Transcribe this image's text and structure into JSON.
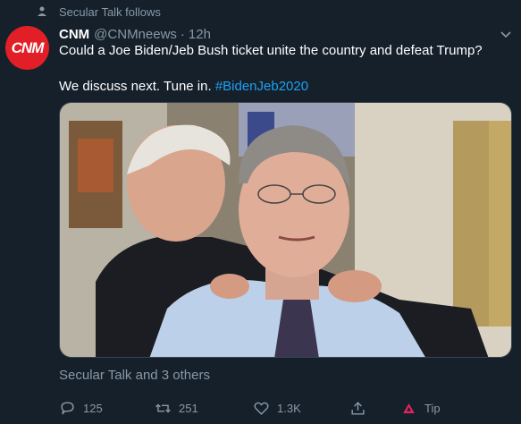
{
  "social_context": {
    "text": "Secular Talk follows",
    "icon": "person-icon"
  },
  "author": {
    "avatar_text": "CNM",
    "name": "CNM",
    "handle": "@CNMneews",
    "separator": "·",
    "time": "12h"
  },
  "tweet": {
    "line1": "Could a Joe Biden/Jeb Bush ticket unite the country and defeat Trump?",
    "line2": "We discuss next. Tune in.",
    "hashtag": "#BidenJeb2020"
  },
  "liked_by": "Secular Talk and 3 others",
  "actions": {
    "reply_count": "125",
    "retweet_count": "251",
    "like_count": "1.3K",
    "tip_label": "Tip"
  },
  "colors": {
    "background": "#15202b",
    "secondary_text": "#8899a6",
    "hashtag": "#1da1f2",
    "avatar_bg": "#e21f26",
    "tip_accent": "#e0245e"
  },
  "icons": [
    "person-icon",
    "chevron-down-icon",
    "reply-icon",
    "retweet-icon",
    "like-icon",
    "share-icon",
    "tip-icon"
  ]
}
